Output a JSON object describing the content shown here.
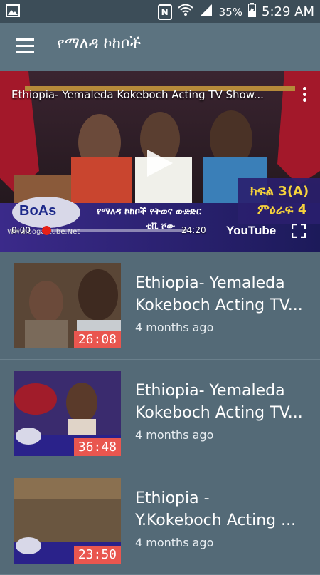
{
  "status": {
    "battery": "35%",
    "time": "5:29 AM",
    "nfc_label": "N"
  },
  "appbar": {
    "title": "የማለዳ ኮከቦች"
  },
  "player": {
    "title": "Ethiopia- Yemaleda Kokeboch Acting TV Show...",
    "elapsed": "0:00",
    "duration": "24:20",
    "progress": 0.0,
    "brand": "YouTube",
    "logo_text": "BoAs",
    "website": "Www.bogastube.Net",
    "overlay_episode": "ክፍል 3(A)",
    "overlay_round": "ምዕራፍ 4",
    "overlay_show": "የማለዳ ኮከቦች የትወና ውድድር",
    "overlay_channel": "ቲቪ ሾው"
  },
  "videos": [
    {
      "title": "Ethiopia- Yemaleda\nKokeboch Acting TV...",
      "meta": "4 months ago",
      "duration": "26:08"
    },
    {
      "title": "Ethiopia- Yemaleda\nKokeboch Acting TV...",
      "meta": "4 months ago",
      "duration": "36:48"
    },
    {
      "title": "Ethiopia -\nY.Kokeboch Acting ...",
      "meta": "4 months ago",
      "duration": "23:50"
    }
  ]
}
